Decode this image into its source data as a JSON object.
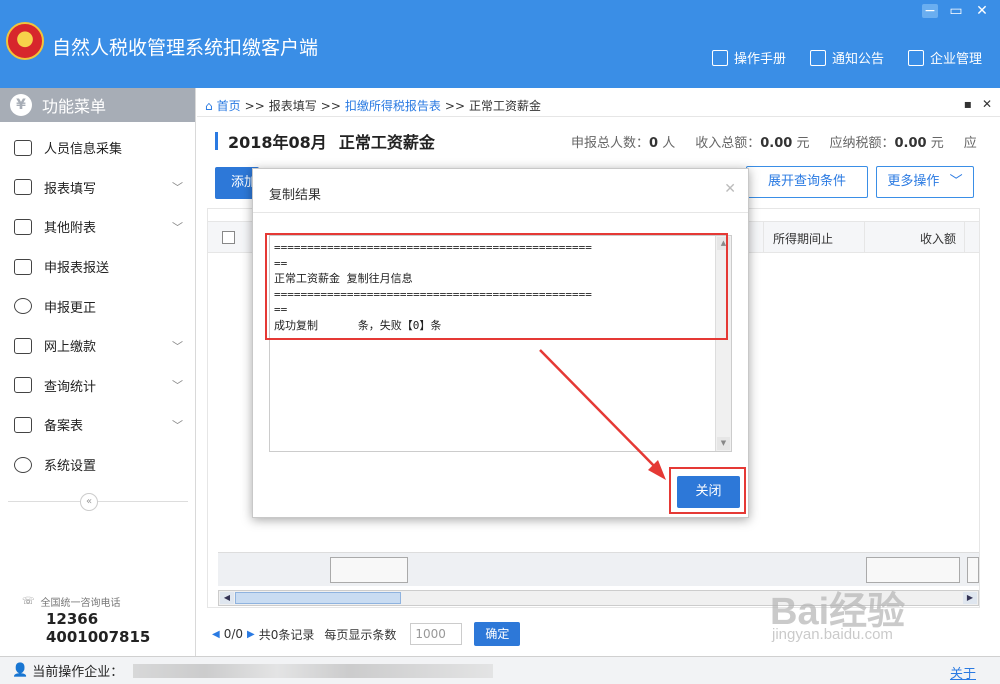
{
  "app": {
    "title": "自然人税收管理系统扣缴客户端",
    "header_links": [
      {
        "label": "操作手册",
        "icon": "manual-icon"
      },
      {
        "label": "通知公告",
        "icon": "mail-icon"
      },
      {
        "label": "企业管理",
        "icon": "building-icon"
      }
    ],
    "window_controls": [
      "minimize",
      "maximize",
      "close"
    ]
  },
  "sidebar": {
    "title": "功能菜单",
    "items": [
      {
        "label": "人员信息采集",
        "icon": "person-icon",
        "expandable": false
      },
      {
        "label": "报表填写",
        "icon": "edit-icon",
        "expandable": true
      },
      {
        "label": "其他附表",
        "icon": "grid-icon",
        "expandable": true
      },
      {
        "label": "申报表报送",
        "icon": "report-send-icon",
        "expandable": false
      },
      {
        "label": "申报更正",
        "icon": "search-icon",
        "expandable": false
      },
      {
        "label": "网上缴款",
        "icon": "folder-icon",
        "expandable": true
      },
      {
        "label": "查询统计",
        "icon": "query-icon",
        "expandable": true
      },
      {
        "label": "备案表",
        "icon": "document-icon",
        "expandable": true
      },
      {
        "label": "系统设置",
        "icon": "gear-icon",
        "expandable": false
      }
    ],
    "collapse_icon": "«",
    "hotline_label": "全国统一咨询电话",
    "hotline_1": "12366",
    "hotline_2": "4001007815"
  },
  "breadcrumb": {
    "home": "首页",
    "sep": ">>",
    "items": [
      "报表填写",
      "扣缴所得税报告表",
      "正常工资薪金"
    ]
  },
  "page": {
    "period": "2018年08月",
    "title": "正常工资薪金",
    "stats": {
      "declared_people_label": "申报总人数：",
      "declared_people_value": "0",
      "declared_people_unit": "人",
      "income_label": "收入总额：",
      "income_value": "0.00",
      "income_unit": "元",
      "tax_label": "应纳税额：",
      "tax_value": "0.00",
      "tax_unit": "元",
      "trailing": "应"
    },
    "toolbar": {
      "add_label": "添加",
      "expand_label": "展开查询条件",
      "more_label": "更多操作"
    },
    "grid": {
      "columns": [
        "所得期间止",
        "收入额"
      ]
    },
    "pager": {
      "current": "0/0",
      "total_label": "共0条记录",
      "page_size_label": "每页显示条数",
      "page_size_placeholder": "1000",
      "confirm_label": "确定"
    }
  },
  "statusbar": {
    "company_label": "当前操作企业：",
    "about_label": "关于"
  },
  "watermark": {
    "line1": "Bai经验",
    "line2": "jingyan.baidu.com"
  },
  "dialog": {
    "title": "复制结果",
    "lines": [
      "================================================",
      "==",
      "正常工资薪金 复制往月信息",
      "================================================",
      "==",
      "成功复制      条，失败【0】条"
    ],
    "close_label": "关闭"
  },
  "colors": {
    "header_bg": "#3a8ee6",
    "primary_button": "#2d78d8",
    "highlight_red": "#e53935",
    "menu_head_bg": "#a7adb6"
  }
}
